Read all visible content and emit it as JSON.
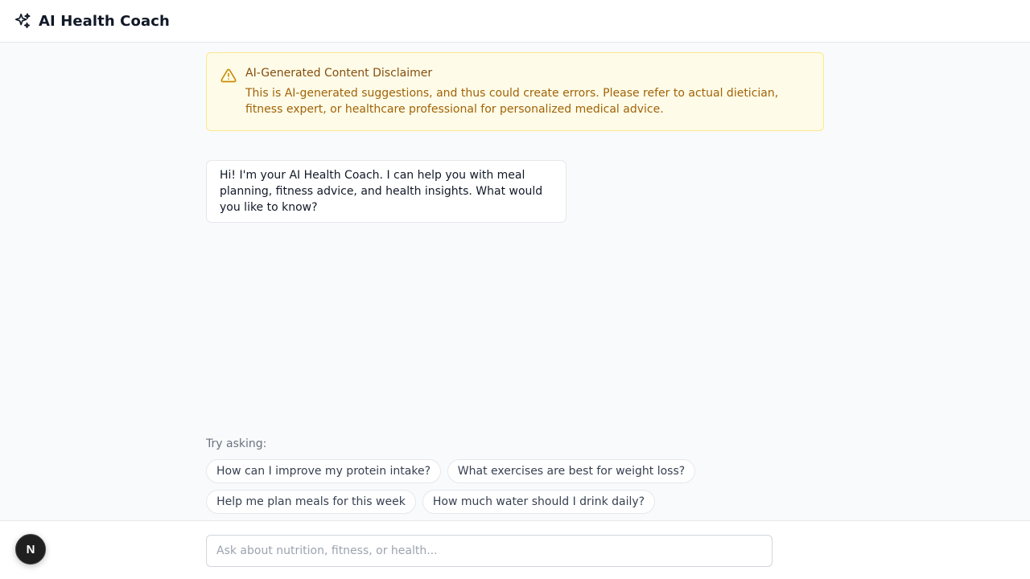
{
  "header": {
    "title": "AI Health Coach",
    "icon": "sparkles-icon"
  },
  "disclaimer": {
    "title": "AI-Generated Content Disclaimer",
    "text": "This is AI-generated suggestions, and thus could create errors. Please refer to actual dietician, fitness expert, or healthcare professional for personalized medical advice.",
    "icon": "warning-triangle-icon",
    "colors": {
      "background": "#fefce8",
      "border": "#fde68a",
      "title": "#854d0e",
      "text": "#a16207"
    }
  },
  "messages": [
    {
      "role": "assistant",
      "text": "Hi! I'm your AI Health Coach. I can help you with meal planning, fitness advice, and health insights. What would you like to know?"
    }
  ],
  "suggestions": {
    "label": "Try asking:",
    "items": [
      "How can I improve my protein intake?",
      "What exercises are best for weight loss?",
      "Help me plan meals for this week",
      "How much water should I drink daily?"
    ]
  },
  "input": {
    "placeholder": "Ask about nutrition, fitness, or health...",
    "value": ""
  },
  "fab": {
    "label": "N"
  }
}
